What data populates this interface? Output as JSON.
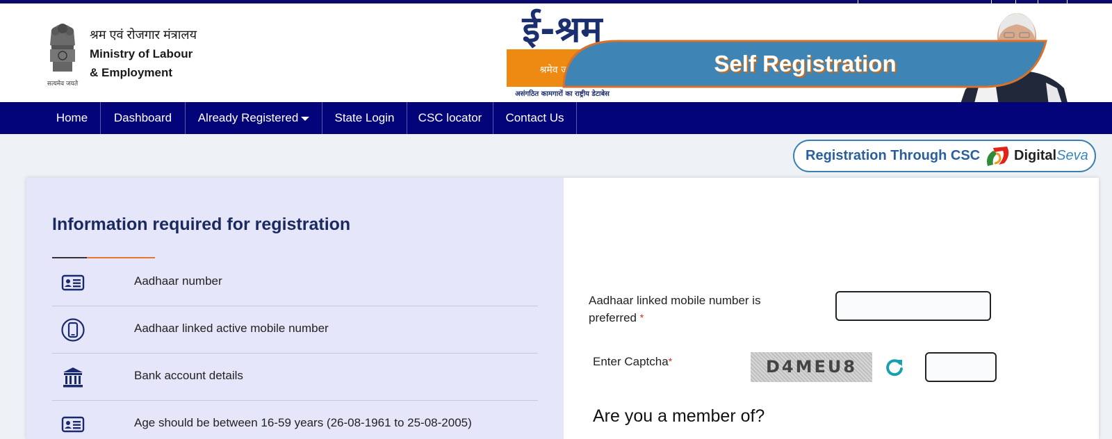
{
  "header": {
    "ministry_hindi": "श्रम एवं रोजगार मंत्रालय",
    "ministry_line1": "Ministry of Labour",
    "ministry_line2": "& Employment",
    "emblem_caption": "सत्यमेव जयते",
    "logo_title": "ई-श्रम",
    "logo_motto": "श्रमेव जयते",
    "logo_tagline": "असंगठित कामगारों का राष्ट्रीय डेटाबेस"
  },
  "nav": {
    "items": [
      "Home",
      "Dashboard",
      "Already Registered",
      "State Login",
      "CSC locator",
      "Contact Us"
    ]
  },
  "csc": {
    "label": "Registration Through CSC",
    "brand_digital": "Digital",
    "brand_seva": "Seva"
  },
  "info": {
    "title": "Information required for registration",
    "items": [
      {
        "text": "Aadhaar number",
        "icon": "id-card-icon"
      },
      {
        "text": "Aadhaar linked active mobile number",
        "icon": "mobile-icon"
      },
      {
        "text": "Bank account details",
        "icon": "bank-icon"
      },
      {
        "text": "Age should be between 16-59 years (26-08-1961 to 25-08-2005)",
        "icon": "id-card-icon"
      }
    ]
  },
  "registration": {
    "title": "Self Registration",
    "mobile_label_line1": "Aadhaar linked mobile number is",
    "mobile_label_line2": "preferred",
    "mobile_value": "",
    "captcha_label": "Enter Captcha",
    "captcha_text": "D4MEU8",
    "captcha_value": "",
    "required_mark": "*",
    "member_question": "Are you a member of?"
  },
  "colors": {
    "nav_bg": "#04047a",
    "accent_orange": "#ee8a12",
    "banner_blue": "#3e84b4",
    "left_panel_bg": "#e6e6fa"
  }
}
